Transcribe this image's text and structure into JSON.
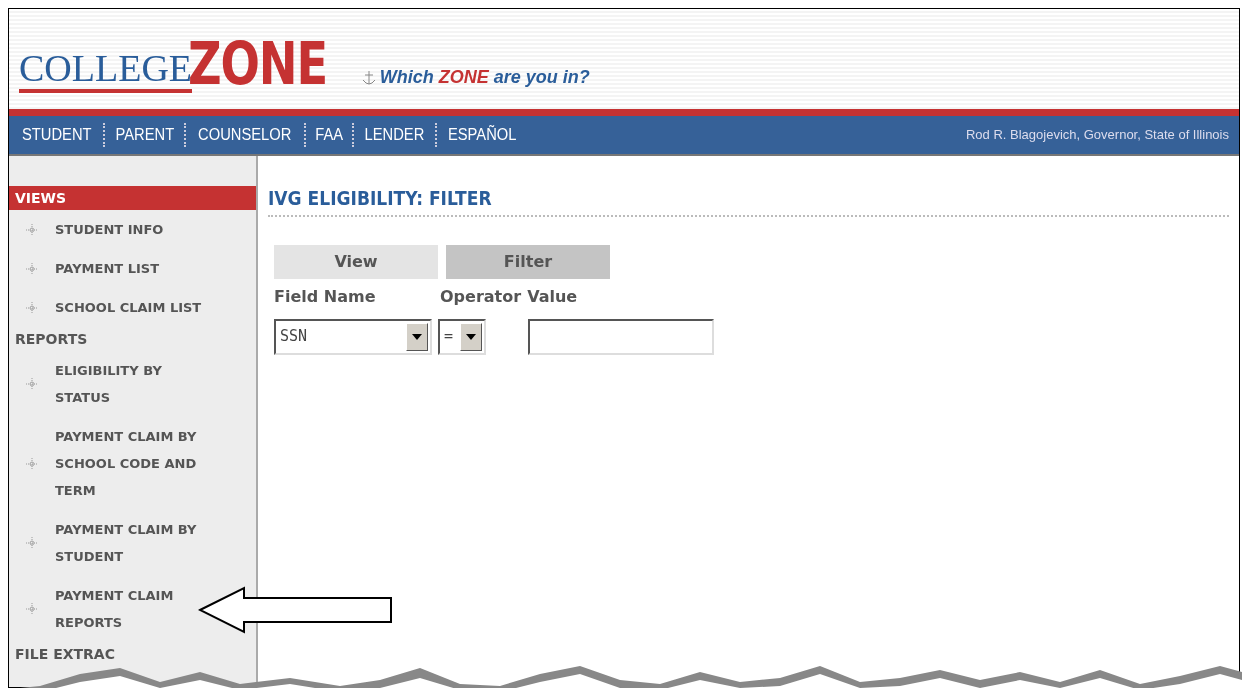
{
  "logo": {
    "part_1": "COLLEGE",
    "part_2": "ZONE"
  },
  "tagline": "Which **ZONE** are you in?",
  "nav": {
    "items": [
      {
        "label": "STUDENT"
      },
      {
        "label": "PARENT"
      },
      {
        "label": "COUNSELOR"
      },
      {
        "label": "FAA"
      },
      {
        "label": "LENDER"
      },
      {
        "label": "ESPAÑOL"
      }
    ],
    "credit": "Rod R. Blagojevich, Governor, State of Illinois"
  },
  "sidebar": {
    "sections": [
      {
        "title": "VIEWS",
        "selected": true,
        "items": [
          {
            "label": "STUDENT INFO"
          },
          {
            "label": "PAYMENT LIST"
          },
          {
            "label": "SCHOOL CLAIM LIST"
          }
        ]
      },
      {
        "title": "REPORTS",
        "selected": false,
        "items": [
          {
            "label": "ELIGIBILITY BY STATUS"
          },
          {
            "label": "PAYMENT CLAIM BY SCHOOL CODE AND TERM"
          },
          {
            "label": "PAYMENT CLAIM BY STUDENT"
          },
          {
            "label": "PAYMENT CLAIM REPORTS"
          }
        ]
      },
      {
        "title": "FILE EXTRAC",
        "selected": false
      }
    ]
  },
  "page_title": "IVG ELIGIBILITY: FILTER",
  "tabs": [
    {
      "label": "View",
      "selected": false
    },
    {
      "label": "Filter",
      "selected": true
    }
  ],
  "filter": {
    "columns": [
      "Field Name",
      "Operator",
      "Value"
    ],
    "field_name": "SSN",
    "operator": "="
  }
}
